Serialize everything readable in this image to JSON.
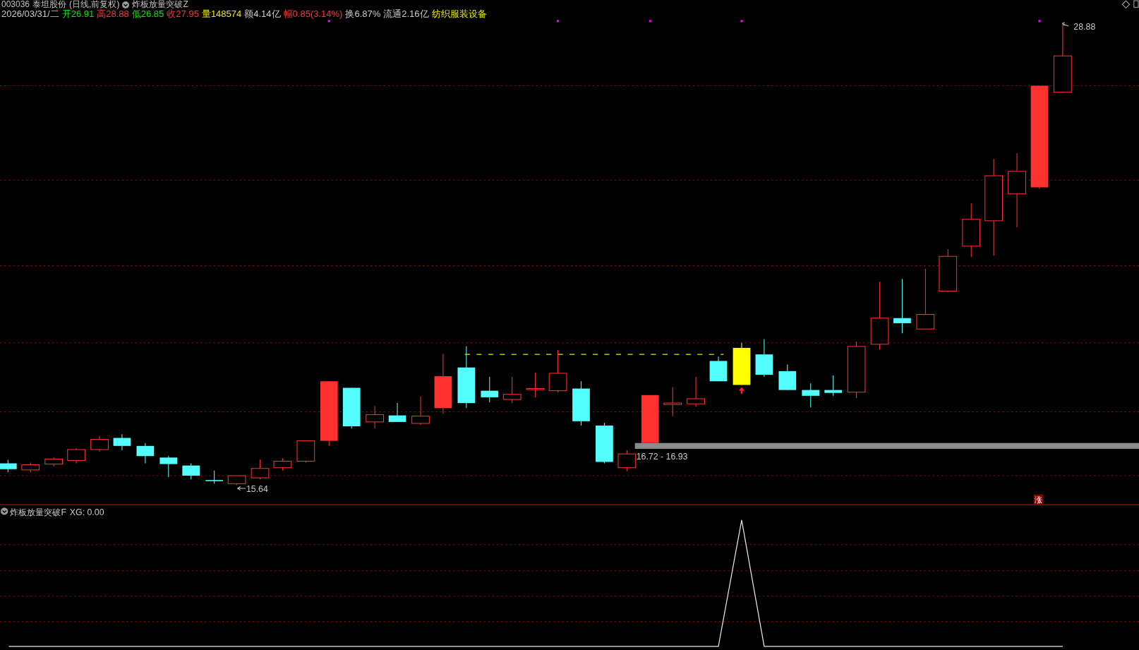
{
  "header": {
    "code": "003036",
    "name": "泰坦股份",
    "period": "(日线,前复权)",
    "indicator": "炸板放量突破Z"
  },
  "quote": [
    {
      "text": "2026/03/31/二",
      "color": "#c8c8c8"
    },
    {
      "text": "开26.91",
      "color": "#00e600"
    },
    {
      "text": "高28.88",
      "color": "#ff3232"
    },
    {
      "text": "低26.85",
      "color": "#00e600"
    },
    {
      "text": "收27.95",
      "color": "#ff3232"
    },
    {
      "text": "量148574",
      "color": "#e6e600"
    },
    {
      "text": "额4.14亿",
      "color": "#c8c8c8"
    },
    {
      "text": "幅0.85(3.14%)",
      "color": "#ff3232"
    },
    {
      "text": "换6.87%",
      "color": "#c8c8c8"
    },
    {
      "text": "流通2.16亿",
      "color": "#c8c8c8"
    },
    {
      "text": "纺织服装设备",
      "color": "#e6e600"
    }
  ],
  "chart": {
    "high_label": "28.88",
    "low_label": "15.64",
    "range_label": "16.72 - 16.93",
    "badge": "涨"
  },
  "sub_panel": {
    "indicator": "炸板放量突破F",
    "reading": "XG: 0.00"
  }
}
